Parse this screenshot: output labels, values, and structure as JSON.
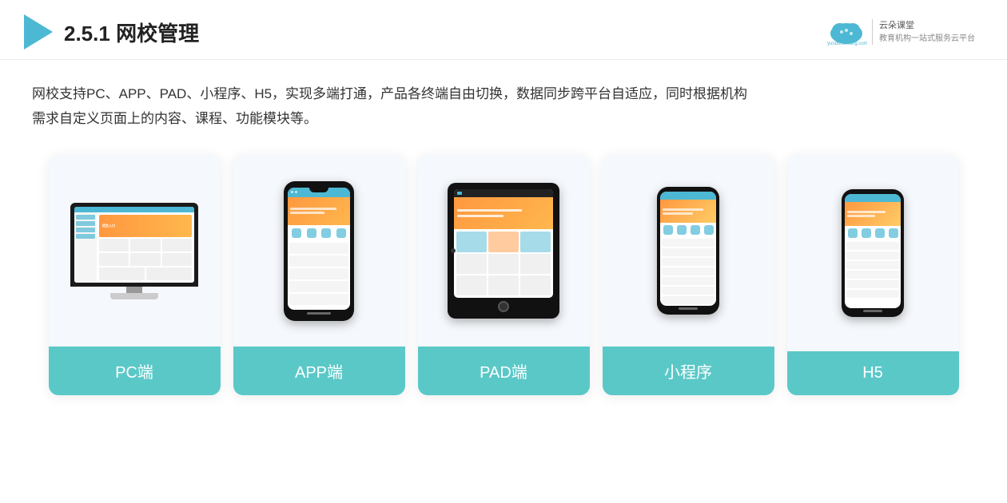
{
  "header": {
    "section_number": "2.5.1",
    "title": "网校管理",
    "brand_name": "云朵课堂",
    "brand_site": "yunduoketang.com",
    "brand_tagline": "教育机构一站\n式服务云平台"
  },
  "description": {
    "text_line1": "网校支持PC、APP、PAD、小程序、H5，实现多端打通，产品各终端自由切换，数据同步跨平台自适应，同时根据机构",
    "text_line2": "需求自定义页面上的内容、课程、功能模块等。"
  },
  "cards": [
    {
      "id": "pc",
      "label": "PC端"
    },
    {
      "id": "app",
      "label": "APP端"
    },
    {
      "id": "pad",
      "label": "PAD端"
    },
    {
      "id": "miniapp",
      "label": "小程序"
    },
    {
      "id": "h5",
      "label": "H5"
    }
  ],
  "colors": {
    "accent": "#5bc8c8",
    "accent_dark": "#4db8d4",
    "orange": "#ff9840"
  }
}
